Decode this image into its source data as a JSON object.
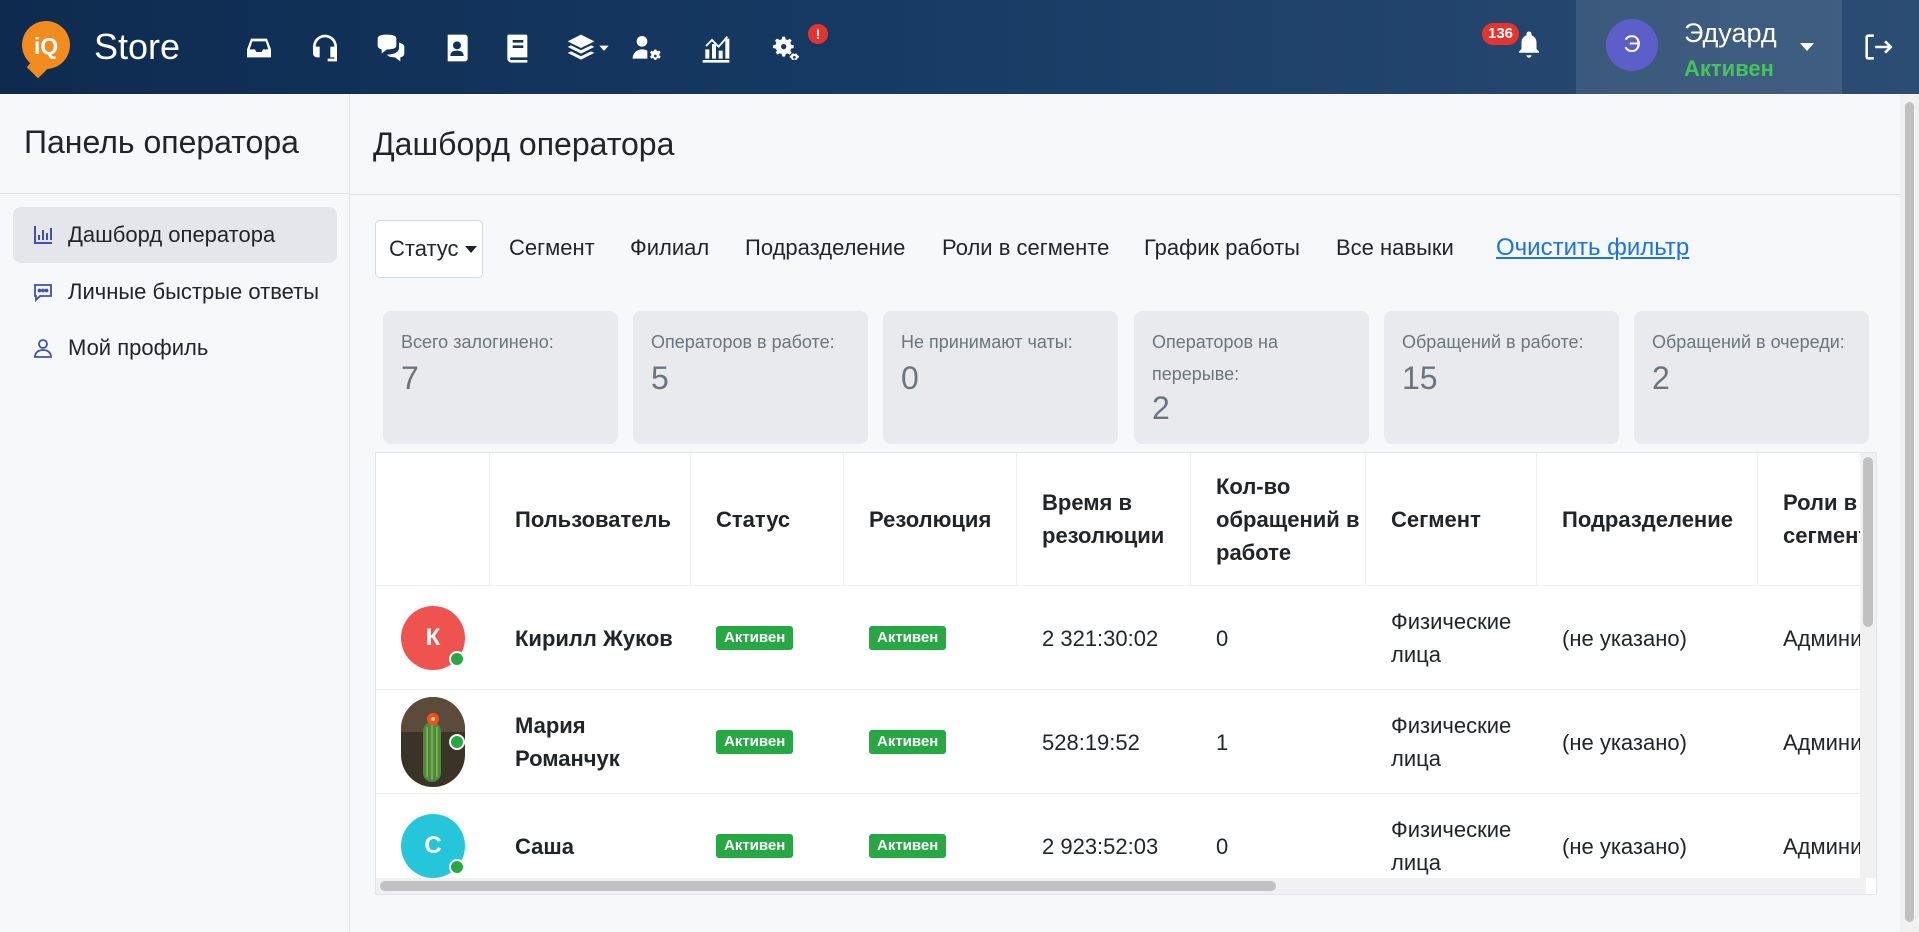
{
  "header": {
    "logo_text": "iQ",
    "app_name": "Store",
    "nav_icons": [
      "inbox-icon",
      "headset-icon",
      "chat-icon",
      "contacts-icon",
      "book-icon",
      "layers-icon",
      "user-settings-icon",
      "chart-icon",
      "gears-icon"
    ],
    "alert_mark": "!",
    "notifications_count": "136",
    "user": {
      "initial": "Э",
      "name": "Эдуард",
      "status": "Активен"
    }
  },
  "sidebar": {
    "title": "Панель оператора",
    "items": [
      {
        "label": "Дашборд оператора",
        "icon": "chart-bar-icon",
        "active": true
      },
      {
        "label": "Личные быстрые ответы",
        "icon": "chat-dots-icon",
        "active": false
      },
      {
        "label": "Мой профиль",
        "icon": "user-icon",
        "active": false
      }
    ]
  },
  "main": {
    "title": "Дашборд оператора",
    "filters": [
      "Статус",
      "Сегмент",
      "Филиал",
      "Подразделение",
      "Роли в сегменте",
      "График работы",
      "Все навыки"
    ],
    "clear_filter": "Очистить фильтр",
    "stats": [
      {
        "label": "Всего залогинено:",
        "value": "7"
      },
      {
        "label": "Операторов в работе:",
        "value": "5"
      },
      {
        "label": "Не принимают чаты:",
        "value": "0"
      },
      {
        "label": "Операторов на перерыве:",
        "value": "2"
      },
      {
        "label": "Обращений в работе:",
        "value": "15"
      },
      {
        "label": "Обращений в очереди:",
        "value": "2"
      }
    ],
    "table": {
      "columns": [
        "Пользователь",
        "Статус",
        "Резолюция",
        "Время в резолюции",
        "Кол-во обращений в работе",
        "Сегмент",
        "Подразделение",
        "Роли в сегменте"
      ],
      "rows": [
        {
          "avatar_letter": "К",
          "avatar_color": "#ef5350",
          "user": "Кирилл Жуков",
          "status": "Активен",
          "resolution": "Активен",
          "time": "2 321:30:02",
          "count": "0",
          "segment": "Физические лица",
          "department": "(не указано)",
          "roles": "Админи"
        },
        {
          "avatar_letter": "",
          "avatar_color": "photo",
          "user": "Мария Романчук",
          "status": "Активен",
          "resolution": "Активен",
          "time": "528:19:52",
          "count": "1",
          "segment": "Физические лица",
          "department": "(не указано)",
          "roles": "Админи"
        },
        {
          "avatar_letter": "С",
          "avatar_color": "#26c6da",
          "user": "Саша",
          "status": "Активен",
          "resolution": "Активен",
          "time": "2 923:52:03",
          "count": "0",
          "segment": "Физические лица",
          "department": "(не указано)",
          "roles": "Админи"
        }
      ]
    }
  }
}
